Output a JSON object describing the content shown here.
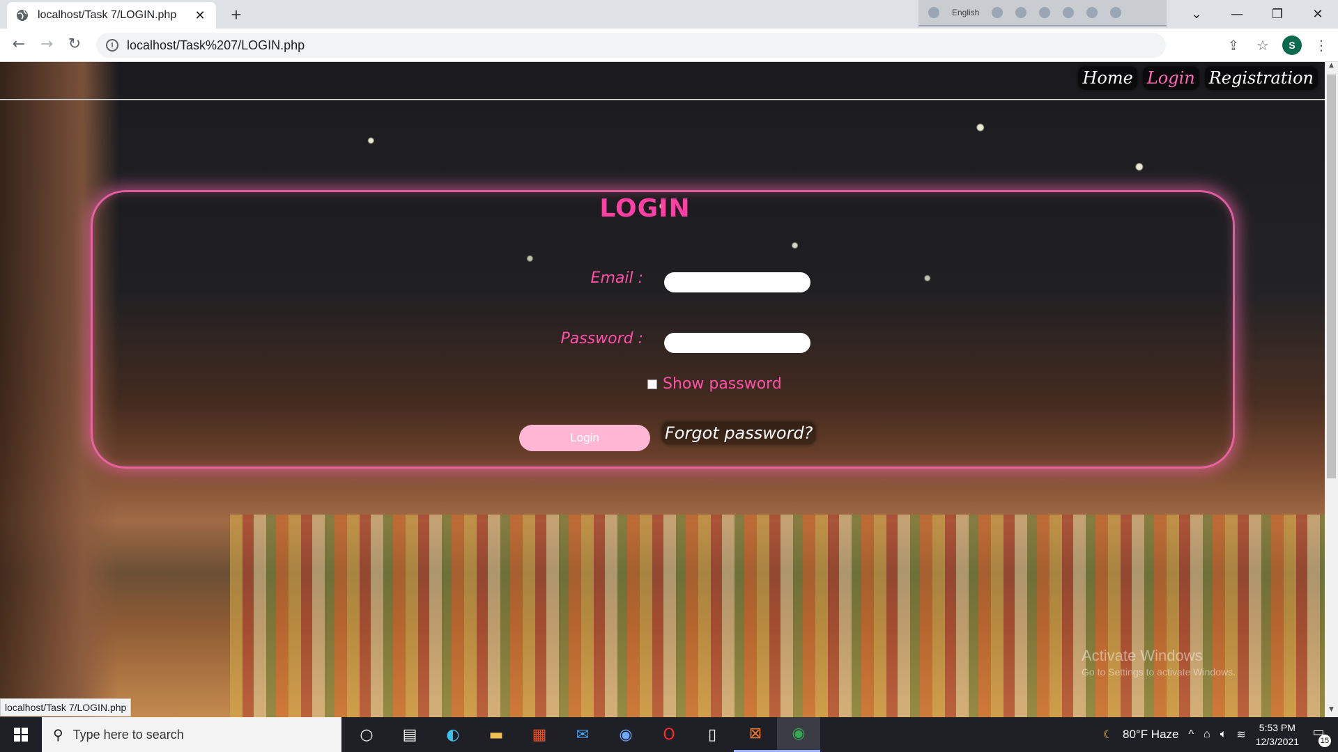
{
  "browser": {
    "tab_title": "localhost/Task 7/LOGIN.php",
    "url": "localhost/Task%207/LOGIN.php",
    "status_url": "localhost/Task 7/LOGIN.php",
    "ime_language": "English",
    "profile_initial": "S"
  },
  "nav": {
    "home": "Home",
    "login": "Login",
    "registration": "Registration"
  },
  "form": {
    "title": "LOGIN",
    "email_label": "Email :",
    "email_value": "",
    "password_label": "Password :",
    "password_value": "",
    "show_password_label": "Show password",
    "show_password_checked": false,
    "login_button": "Login",
    "forgot_link": "Forgot password?"
  },
  "watermark": {
    "line1": "Activate Windows",
    "line2": "Go to Settings to activate Windows."
  },
  "taskbar": {
    "search_placeholder": "Type here to search",
    "weather": "80°F  Haze",
    "time": "5:53 PM",
    "date": "12/3/2021",
    "notification_count": "15",
    "icons": [
      "cortana-icon",
      "task-view-icon",
      "edge-icon",
      "file-explorer-icon",
      "store-icon",
      "mail-icon",
      "chromium-icon",
      "opera-icon",
      "notepad-icon",
      "xampp-icon",
      "chrome-icon"
    ]
  },
  "colors": {
    "accent_pink": "#ff4fa8",
    "title_pink": "#ff3fa4",
    "login_button": "#ffb7d5",
    "panel_glow": "#ff69b4"
  }
}
